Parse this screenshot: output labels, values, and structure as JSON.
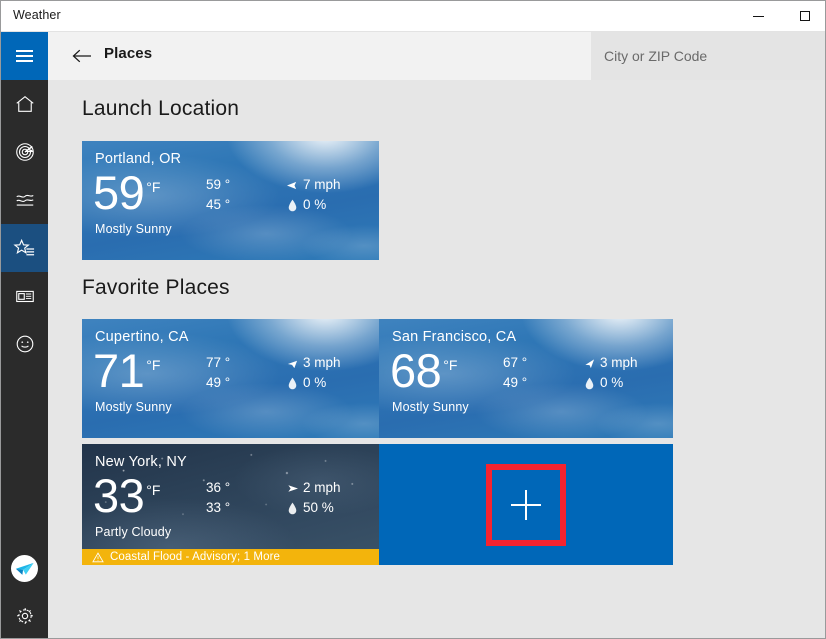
{
  "window": {
    "title": "Weather",
    "minimize_label": "–",
    "maximize_label": "□"
  },
  "commandbar": {
    "back_label": "←",
    "page_title": "Places",
    "search_placeholder": "City or ZIP Code",
    "search_value": ""
  },
  "sidebar": {
    "items": [
      {
        "name": "hamburger",
        "label": "Navigation"
      },
      {
        "name": "home",
        "label": "Forecast"
      },
      {
        "name": "radar",
        "label": "Maps"
      },
      {
        "name": "historical",
        "label": "Historical Weather"
      },
      {
        "name": "favorites",
        "label": "Places",
        "selected": true
      },
      {
        "name": "news",
        "label": "News"
      },
      {
        "name": "feedback",
        "label": "Send Feedback"
      }
    ],
    "bottom_items": [
      {
        "name": "account",
        "label": "Account"
      },
      {
        "name": "settings",
        "label": "Settings"
      }
    ]
  },
  "sections": {
    "launch_location_title": "Launch Location",
    "favorite_places_title": "Favorite Places"
  },
  "launch_location": {
    "city": "Portland, OR",
    "temp": "59",
    "unit": "°F",
    "high": "59 °",
    "low": "45 °",
    "wind": "7 mph",
    "precip": "0 %",
    "condition": "Mostly Sunny",
    "sky": "day"
  },
  "favorites": [
    {
      "city": "Cupertino, CA",
      "temp": "71",
      "unit": "°F",
      "high": "77 °",
      "low": "49 °",
      "wind": "3 mph",
      "precip": "0 %",
      "condition": "Mostly Sunny",
      "sky": "day",
      "alert": null
    },
    {
      "city": "San Francisco, CA",
      "temp": "68",
      "unit": "°F",
      "high": "67 °",
      "low": "49 °",
      "wind": "3 mph",
      "precip": "0 %",
      "condition": "Mostly Sunny",
      "sky": "day",
      "alert": null
    },
    {
      "city": "New York, NY",
      "temp": "33",
      "unit": "°F",
      "high": "36 °",
      "low": "33 °",
      "wind": "2 mph",
      "precip": "50 %",
      "condition": "Partly Cloudy",
      "sky": "night",
      "alert": "Coastal Flood - Advisory; 1 More"
    }
  ],
  "add_tile": {
    "label": "+",
    "name": "add-place-tile"
  },
  "colors": {
    "accent_blue": "#0067b8",
    "nav_background": "#2b2b2b",
    "nav_selected": "#1b4f80",
    "content_background": "#e6e6e6",
    "commandbar_background": "#f2f2f2",
    "search_background": "#e4e4e4",
    "alert_amber": "#f3b40c",
    "highlight_red": "#f6232f"
  }
}
